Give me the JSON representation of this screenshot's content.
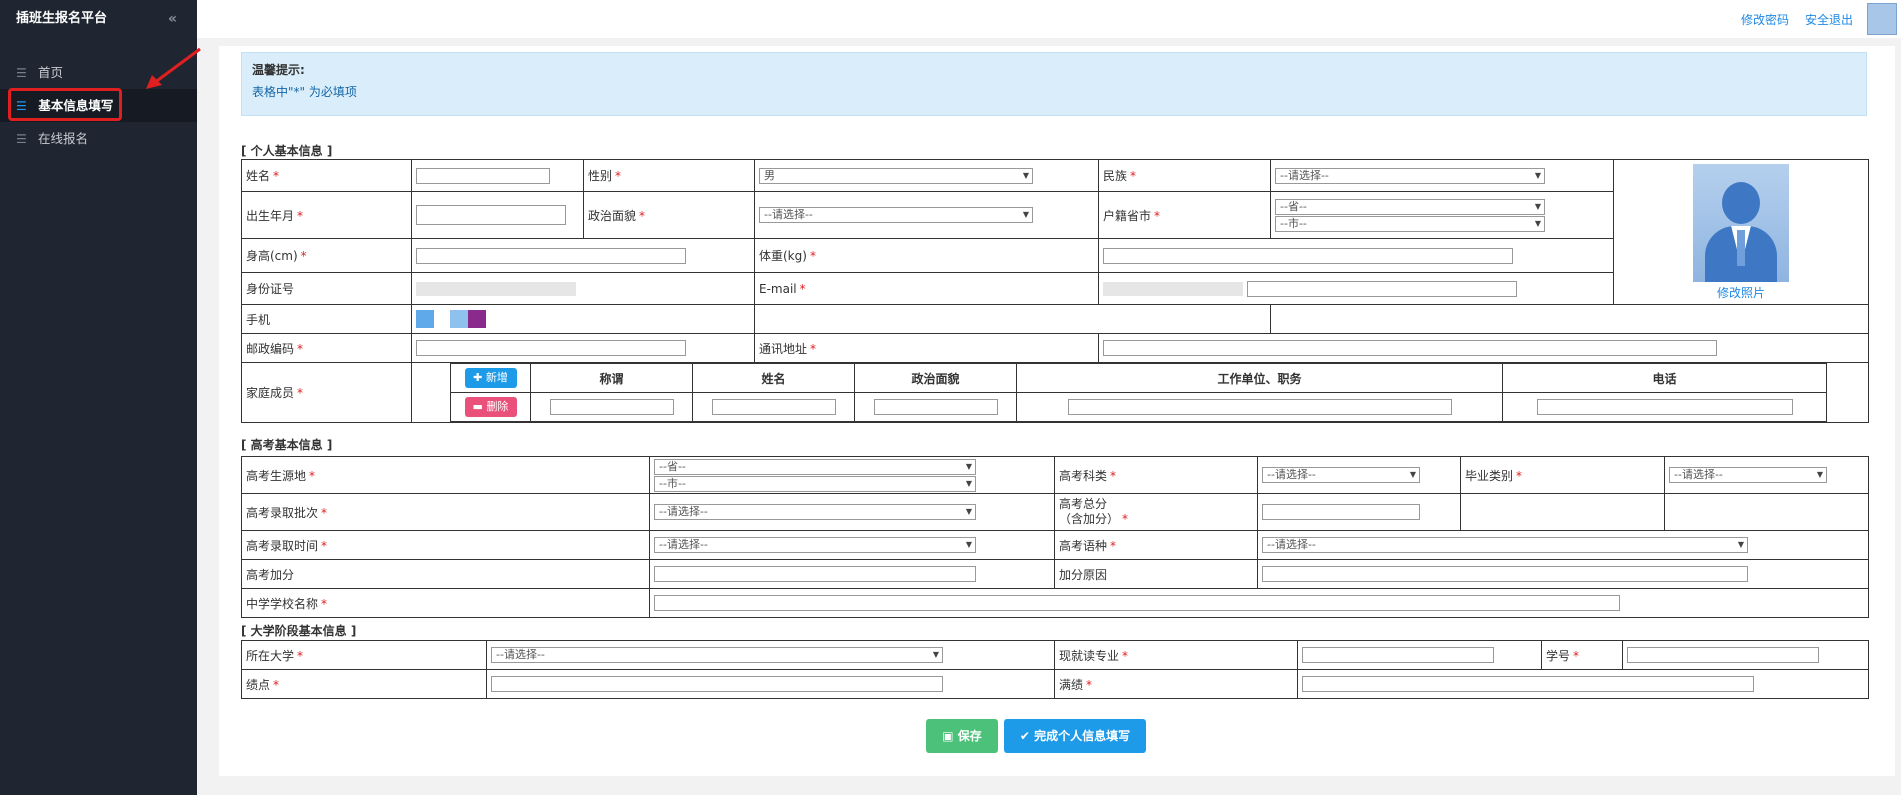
{
  "sidebar": {
    "brand": "插班生报名平台",
    "collapse_glyph": "«",
    "items": [
      {
        "label": "首页"
      },
      {
        "label": "基本信息填写"
      },
      {
        "label": "在线报名"
      }
    ]
  },
  "topbar": {
    "change_password": "修改密码",
    "logout": "安全退出"
  },
  "tip": {
    "title": "温馨提示:",
    "text": "表格中\"*\" 为必填项"
  },
  "personal": {
    "section": "[ 个人基本信息 ]",
    "name": "姓名",
    "gender": "性别",
    "gender_value": "男",
    "ethnicity": "民族",
    "ethnicity_value": "--请选择--",
    "birth": "出生年月",
    "political": "政治面貌",
    "political_value": "--请选择--",
    "hukou": "户籍省市",
    "province_value": "--省--",
    "city_value": "--市--",
    "height": "身高(cm)",
    "weight": "体重(kg)",
    "idcard": "身份证号",
    "email": "E-mail",
    "mobile": "手机",
    "postcode": "邮政编码",
    "address": "通讯地址",
    "family": "家庭成员",
    "photo_link": "修改照片",
    "add_btn": "新增",
    "del_btn": "删除",
    "family_headers": [
      "称谓",
      "姓名",
      "政治面貌",
      "工作单位、职务",
      "电话"
    ]
  },
  "gaokao": {
    "section": "[ 高考基本信息 ]",
    "origin": "高考生源地",
    "province_value": "--省--",
    "city_value": "--市--",
    "subject": "高考科类",
    "subject_value": "--请选择--",
    "grad_type": "毕业类别",
    "grad_type_value": "--请选择--",
    "batch": "高考录取批次",
    "batch_value": "--请选择--",
    "total_line1": "高考总分",
    "total_line2": "（含加分）",
    "time": "高考录取时间",
    "time_value": "--请选择--",
    "lang": "高考语种",
    "lang_value": "--请选择--",
    "bonus": "高考加分",
    "bonus_reason": "加分原因",
    "school": "中学学校名称"
  },
  "college": {
    "section": "[ 大学阶段基本信息 ]",
    "university": "所在大学",
    "university_value": "--请选择--",
    "major": "现就读专业",
    "student_no": "学号",
    "gpa": "绩点",
    "score": "满绩"
  },
  "actions": {
    "save": "保存",
    "finish": "完成个人信息填写"
  },
  "colors": {
    "sidebar_bg": "#1f2631",
    "accent": "#1e88e5",
    "required": "#e02020",
    "save_btn": "#4cc17a",
    "finish_btn": "#1e9be8",
    "tip_bg": "#d9eefa"
  }
}
